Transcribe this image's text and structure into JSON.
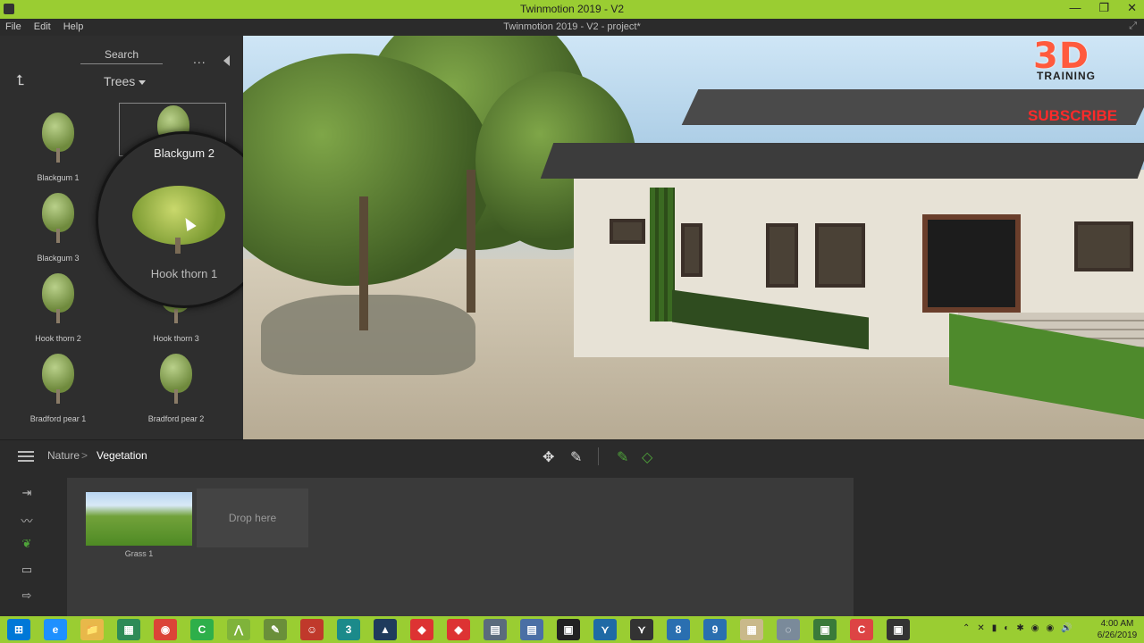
{
  "window": {
    "title": "Twinmotion 2019 - V2",
    "subtitle": "Twinmotion 2019 - V2 - project*",
    "min": "—",
    "max": "❐",
    "close": "✕",
    "resize": "⤢"
  },
  "menu": [
    "File",
    "Edit",
    "Help"
  ],
  "library": {
    "search_label": "Search",
    "more": "...",
    "back_icon": "⮤",
    "category": "Trees",
    "assets": [
      {
        "label": "Blackgum 1"
      },
      {
        "label": "Blackgum 2"
      },
      {
        "label": "Blackgum 3"
      },
      {
        "label": "Hook thorn 1"
      },
      {
        "label": "Hook thorn 2"
      },
      {
        "label": "Hook thorn 3"
      },
      {
        "label": "Bradford pear 1"
      },
      {
        "label": "Bradford pear 2"
      }
    ],
    "magnifier": {
      "title": "Blackgum 2",
      "label": "Hook thorn 1"
    }
  },
  "viewport": {
    "watermark_logo": "3D",
    "watermark_sub": "TRAINING",
    "subscribe": "SUBSCRIBE"
  },
  "breadcrumb": {
    "root": "Nature",
    "sep": ">",
    "current": "Vegetation"
  },
  "tools": {
    "move": "✥",
    "eyedropper": "✎",
    "paint": "✎",
    "erase": "◇"
  },
  "rail": {
    "import": "⇥",
    "analyze": "〰",
    "nature": "❦",
    "media": "▭",
    "export": "⇨"
  },
  "bottom": {
    "grass_label": "Grass 1",
    "drop_label": "Drop here"
  },
  "taskbar": {
    "apps": [
      "⊞",
      "e",
      "📁",
      "▦",
      "◉",
      "C",
      "⋀",
      "✎",
      "☺",
      "3",
      "▲",
      "◆",
      "◆",
      "▤",
      "▤",
      "▣",
      "⋎",
      "⋎",
      "8",
      "9",
      "▦",
      "◌",
      "▣",
      "C",
      "▣"
    ],
    "tray": [
      "⌃",
      "✕",
      "▮",
      "◐",
      "✱",
      "◉",
      "◉",
      "🔊"
    ],
    "time": "4:00 AM",
    "date": "6/26/2019"
  },
  "colors": {
    "accent_green": "#9acd32",
    "watermark_red": "#ff5a3d",
    "tool_green": "#4fa33a"
  }
}
